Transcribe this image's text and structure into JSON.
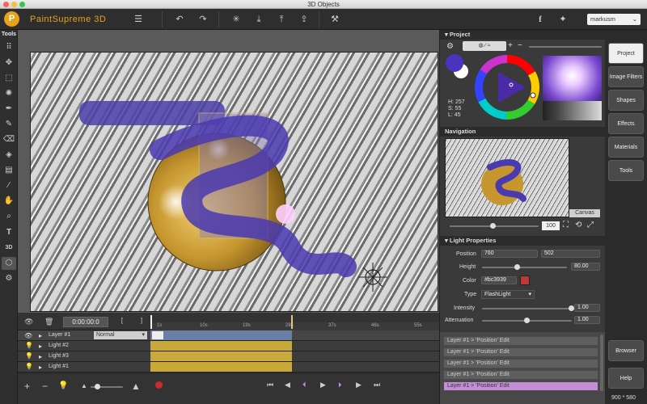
{
  "window_title": "3D Objects",
  "app_name": "PaintSupreme 3D",
  "user": "markusm",
  "tools_label": "Tools",
  "panel": {
    "project_title": "Project",
    "color": {
      "h": "H: 257",
      "s": "S: 55",
      "l": "L: 45",
      "primary": "#4c33bd",
      "secondary": "#ffffff"
    },
    "navigation_title": "Navigation",
    "canvas_label": "Canvas",
    "zoom_value": "100",
    "light_title": "Light Properties",
    "position_label": "Position",
    "position_x": "760",
    "position_y": "502",
    "height_label": "Height",
    "height_value": "80.00",
    "color_label": "Color",
    "color_value": "#bc3939",
    "type_label": "Type",
    "type_value": "FlashLight",
    "intensity_label": "Intensity",
    "intensity_value": "1.00",
    "attenuation_label": "Attenuation",
    "attenuation_value": "1.00"
  },
  "history": [
    "Layer #1 >  'Position' Edit",
    "Layer #1 >  'Position' Edit",
    "Layer #1 >  'Position' Edit",
    "Layer #1 >  'Position' Edit",
    "Layer #1 >  'Position' Edit"
  ],
  "right_buttons": [
    "Project",
    "Image Filters",
    "Shapes",
    "Effects",
    "Materials",
    "Tools"
  ],
  "browser_label": "Browser",
  "help_label": "Help",
  "size_label": "900 * 580",
  "timeline": {
    "timecode": "0:00:00:0",
    "bracket_open": "[",
    "bracket_close": "]",
    "ticks": [
      "1s",
      "10s",
      "19s",
      "28s",
      "37s",
      "46s",
      "55s"
    ],
    "blend_mode": "Normal",
    "layers": [
      "Layer #1",
      "Light #2",
      "Light #3",
      "Light #1"
    ]
  }
}
